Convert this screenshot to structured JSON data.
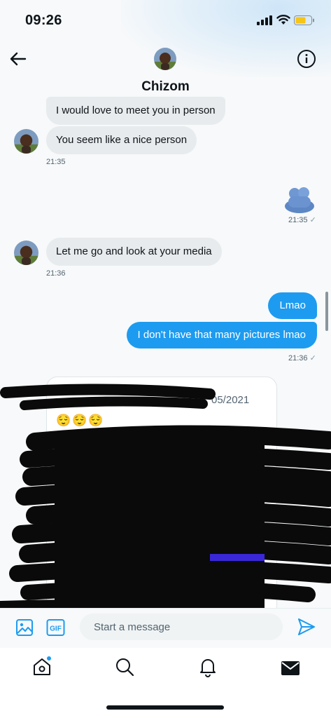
{
  "status_bar": {
    "time": "09:26"
  },
  "header": {
    "name": "Chizom"
  },
  "messages": {
    "in_1": "I would love to meet you in person",
    "in_2": "You seem like a nice person",
    "ts_1": "21:35",
    "ts_2": "21:35",
    "in_3": "Let me go and look at your media",
    "ts_3": "21:36",
    "out_1": "Lmao",
    "out_2": "I don't have that many pictures lmao",
    "ts_4": "21:36"
  },
  "shared_card": {
    "date_fragment": "05/2021",
    "emojis": "😌😌😌"
  },
  "composer": {
    "placeholder": "Start a message"
  },
  "tabs": [
    "home",
    "search",
    "notifications",
    "messages"
  ],
  "colors": {
    "accent": "#1d9bf0",
    "incoming_bubble": "#e7ebed",
    "background": "#f7f9fa"
  }
}
